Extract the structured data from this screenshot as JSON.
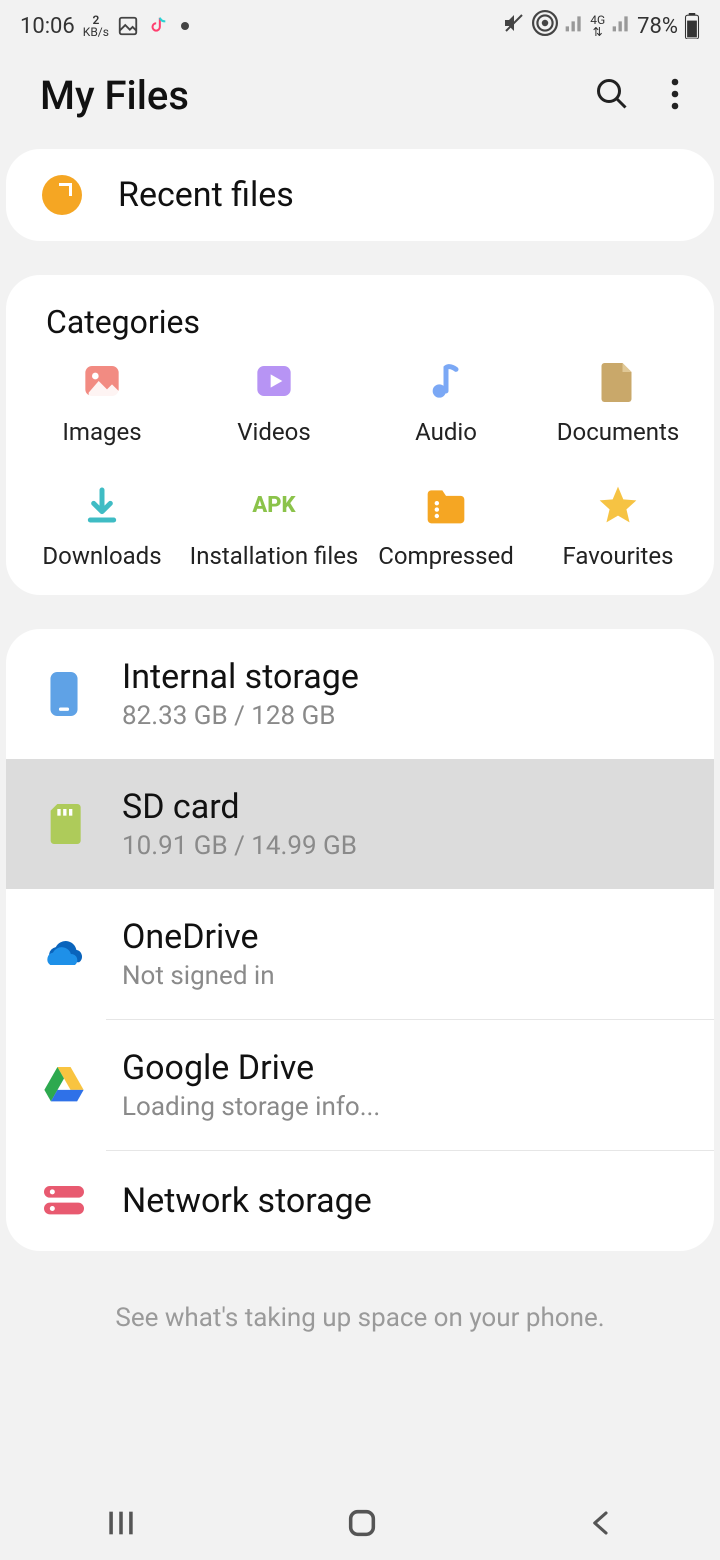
{
  "statusbar": {
    "time": "10:06",
    "kb_top": "2",
    "kb_bot": "KB/s",
    "battery": "78%"
  },
  "header": {
    "title": "My Files"
  },
  "recent": {
    "label": "Recent files"
  },
  "categories": {
    "title": "Categories",
    "items": [
      {
        "label": "Images"
      },
      {
        "label": "Videos"
      },
      {
        "label": "Audio"
      },
      {
        "label": "Documents"
      },
      {
        "label": "Downloads"
      },
      {
        "label": "Installation files"
      },
      {
        "label": "Compressed"
      },
      {
        "label": "Favourites"
      }
    ]
  },
  "storage": {
    "internal": {
      "title": "Internal storage",
      "sub": "82.33 GB / 128 GB"
    },
    "sd": {
      "title": "SD card",
      "sub": "10.91 GB / 14.99 GB"
    },
    "onedrive": {
      "title": "OneDrive",
      "sub": "Not signed in"
    },
    "gdrive": {
      "title": "Google Drive",
      "sub": "Loading storage info..."
    },
    "network": {
      "title": "Network storage"
    }
  },
  "footer": {
    "hint": "See what's taking up space on your phone."
  }
}
